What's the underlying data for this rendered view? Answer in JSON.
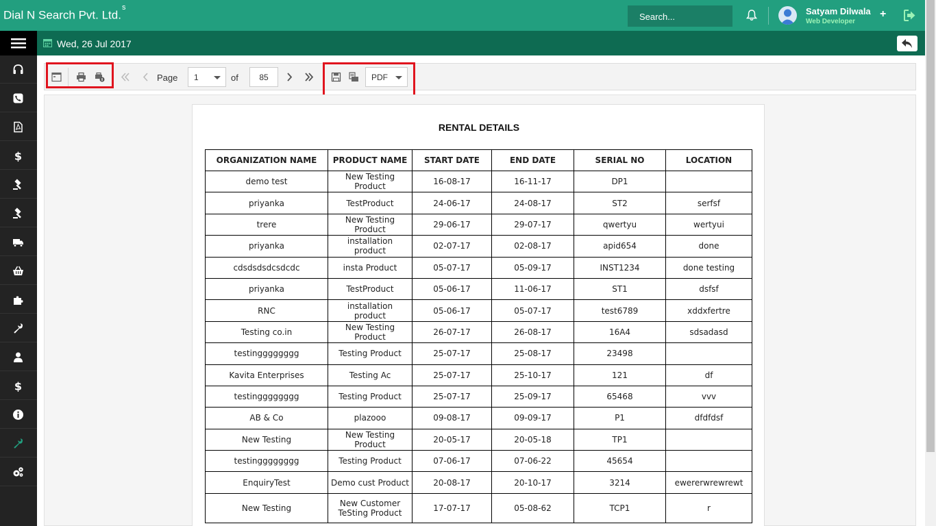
{
  "header": {
    "brand": "Dial N Search Pvt. Ltd.",
    "brand_sup": "s",
    "search_placeholder": "Search...",
    "user_name": "Satyam Dilwala",
    "user_role": "Web Developer",
    "plus": "+"
  },
  "subbar": {
    "date": "Wed, 26 Jul 2017"
  },
  "sidebar": {
    "icons": [
      "headset-icon",
      "phone-icon",
      "pdf-icon",
      "dollar-icon",
      "gavel-icon",
      "gavel-icon",
      "truck-icon",
      "basket-icon",
      "puzzle-icon",
      "wrench-icon",
      "user-icon",
      "dollar-icon",
      "info-icon",
      "wrench-icon",
      "gears-icon"
    ],
    "active_index": 13,
    "accent": "#229f7f"
  },
  "toolbar": {
    "page_label": "Page",
    "page_value": "1",
    "of_label": "of",
    "total_pages": "85",
    "export_format": "PDF"
  },
  "report": {
    "title": "RENTAL DETAILS",
    "columns": [
      "ORGANIZATION NAME",
      "PRODUCT NAME",
      "START DATE",
      "END DATE",
      "SERIAL NO",
      "LOCATION"
    ],
    "rows": [
      [
        "demo test",
        "New Testing Product",
        "16-08-17",
        "16-11-17",
        "DP1",
        ""
      ],
      [
        "priyanka",
        "TestProduct",
        "24-06-17",
        "24-08-17",
        "ST2",
        "serfsf"
      ],
      [
        "trere",
        "New Testing Product",
        "29-06-17",
        "29-07-17",
        "qwertyu",
        "wertyui"
      ],
      [
        "priyanka",
        "installation product",
        "02-07-17",
        "02-08-17",
        "apid654",
        "done"
      ],
      [
        "cdsdsdsdcsdcdc",
        "insta Product",
        "05-07-17",
        "05-09-17",
        "INST1234",
        "done testing"
      ],
      [
        "priyanka",
        "TestProduct",
        "05-06-17",
        "11-06-17",
        "ST1",
        "dsfsf"
      ],
      [
        "RNC",
        "installation product",
        "05-06-17",
        "05-07-17",
        "test6789",
        "xddxfertre"
      ],
      [
        "Testing co.in",
        "New Testing Product",
        "26-07-17",
        "26-08-17",
        "16A4",
        "sdsadasd"
      ],
      [
        "testingggggggg",
        "Testing Product",
        "25-07-17",
        "25-08-17",
        "23498",
        ""
      ],
      [
        "Kavita Enterprises",
        "Testing Ac",
        "25-07-17",
        "25-10-17",
        "121",
        "df"
      ],
      [
        "testingggggggg",
        "Testing Product",
        "25-07-17",
        "25-09-17",
        "65468",
        "vvv"
      ],
      [
        "AB & Co",
        "plazooo",
        "09-08-17",
        "09-09-17",
        "P1",
        "dfdfdsf"
      ],
      [
        "New Testing",
        "New Testing Product",
        "20-05-17",
        "20-05-18",
        "TP1",
        ""
      ],
      [
        "testingggggggg",
        "Testing Product",
        "07-06-17",
        "07-06-22",
        "45654",
        ""
      ],
      [
        "EnquiryTest",
        "Demo cust Product",
        "20-08-17",
        "20-10-17",
        "3214",
        "ewererwrewrewt"
      ],
      [
        "New Testing",
        "New Customer TeSting Product",
        "17-07-17",
        "05-08-62",
        "TCP1",
        "r"
      ]
    ]
  },
  "colors": {
    "topbar": "#229f7f",
    "subbar": "#0e6b52",
    "sidebar": "#232323",
    "highlight_box": "#e0141e"
  }
}
